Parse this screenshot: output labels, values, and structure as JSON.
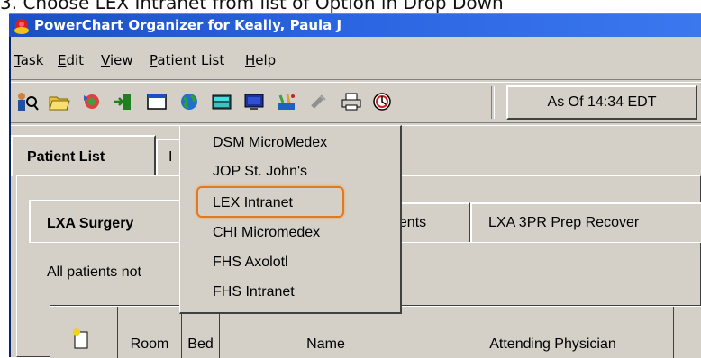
{
  "caption": "3. Choose LEX Intranet from list of Option in Drop Down",
  "window": {
    "title": "PowerChart Organizer for Keally, Paula J"
  },
  "menu": [
    "Task",
    "Edit",
    "View",
    "Patient List",
    "Help"
  ],
  "toolbar": {
    "icons": [
      "patient-search-icon",
      "folder-open-icon",
      "refresh-icon",
      "exit-icon",
      "window-icon",
      "web-globe-icon",
      "calculator-icon",
      "monitor-icon",
      "plug-icon",
      "print-icon",
      "clock-icon"
    ],
    "as_of": "As Of 14:34 EDT"
  },
  "tabs": {
    "main": "Patient List",
    "second_partial": "I"
  },
  "subtabs": {
    "surgery": "LXA Surgery",
    "appointments_partial": "nents",
    "recovery": "LXA 3PR Prep Recover"
  },
  "filter_text": "All patients not",
  "table": {
    "headers": [
      "Room",
      "Bed",
      "Name",
      "Attending Physician"
    ]
  },
  "dropdown": {
    "items": [
      "DSM MicroMedex",
      "JOP St. John's",
      "LEX Intranet",
      "CHI Micromedex",
      "FHS Axolotl",
      "FHS Intranet"
    ],
    "highlighted": "LEX Intranet"
  }
}
